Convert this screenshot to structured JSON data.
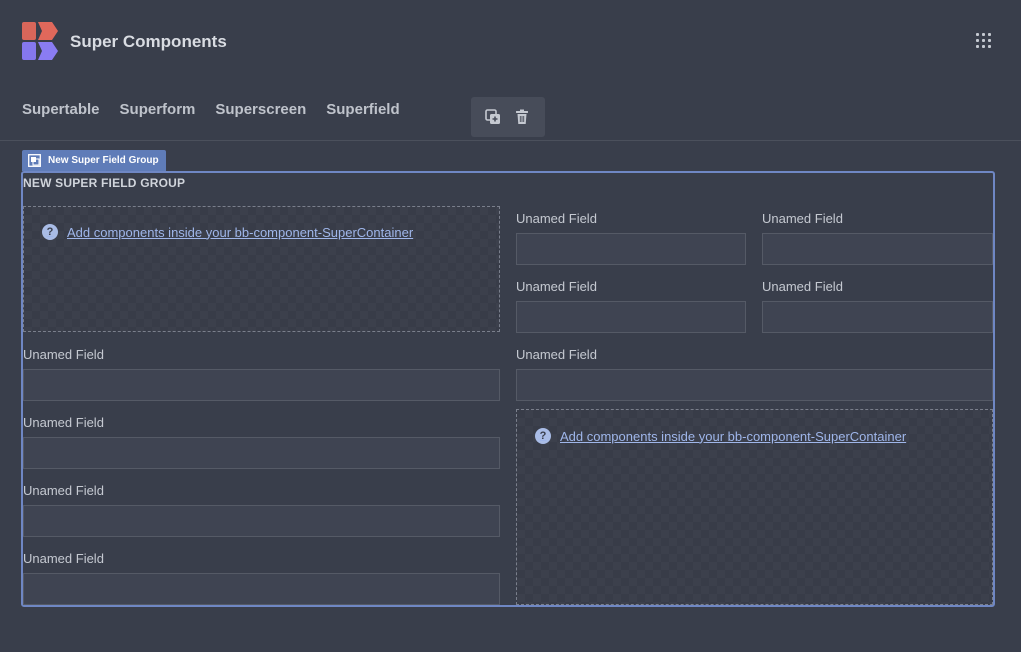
{
  "header": {
    "title": "Super Components",
    "logo_colors": [
      "#e0685b",
      "#8a7cf3"
    ]
  },
  "nav": {
    "items": [
      {
        "label": "Supertable"
      },
      {
        "label": "Superform"
      },
      {
        "label": "Superscreen"
      },
      {
        "label": "Superfield"
      }
    ]
  },
  "toolbar": {
    "duplicate_icon": "duplicate-icon",
    "delete_icon": "trash-icon"
  },
  "group": {
    "tag_label": "New Super Field Group",
    "title": "NEW SUPER FIELD GROUP",
    "accent": "#6f87c4"
  },
  "containers": {
    "message": "Add components inside your bb-component-SuperContainer",
    "help_glyph": "?"
  },
  "fields": {
    "label": "Unamed Field",
    "value": ""
  }
}
